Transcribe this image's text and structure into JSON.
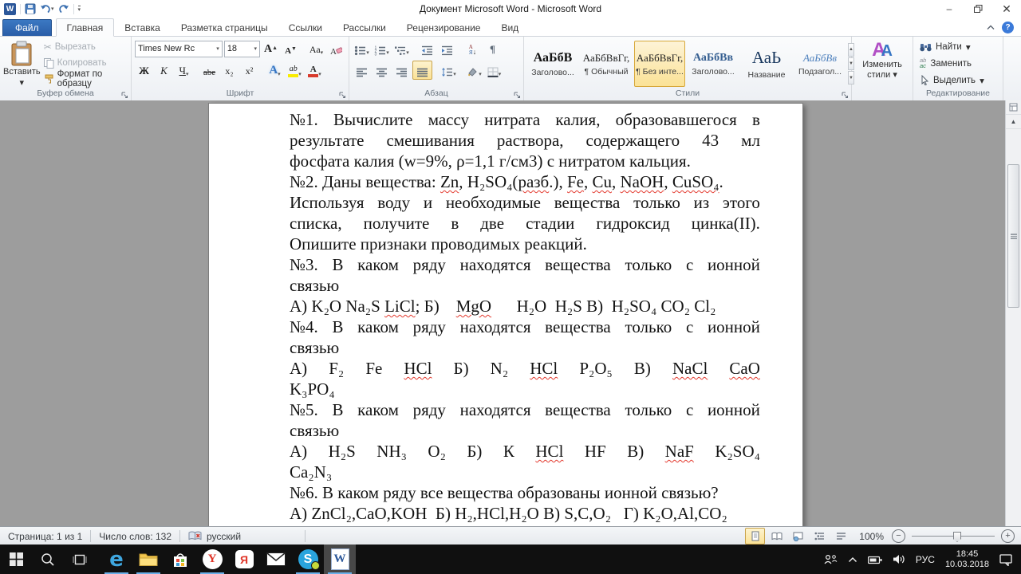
{
  "title_bar": {
    "title": "Документ Microsoft Word  -  Microsoft Word"
  },
  "ribbon": {
    "tabs": [
      {
        "label": "Файл"
      },
      {
        "label": "Главная"
      },
      {
        "label": "Вставка"
      },
      {
        "label": "Разметка страницы"
      },
      {
        "label": "Ссылки"
      },
      {
        "label": "Рассылки"
      },
      {
        "label": "Рецензирование"
      },
      {
        "label": "Вид"
      }
    ],
    "clipboard": {
      "label": "Буфер обмена",
      "paste": "Вставить",
      "cut": "Вырезать",
      "copy": "Копировать",
      "format_painter": "Формат по образцу"
    },
    "font": {
      "label": "Шрифт",
      "name": "Times New Rc",
      "size": "18",
      "bold": "Ж",
      "italic": "К",
      "underline": "Ч",
      "strike": "abe",
      "subscript": "x₂",
      "superscript": "x²",
      "case_btn": "Аа",
      "effects_letter": "А",
      "highlight_letters": "ab",
      "color_letter": "А",
      "highlight_color": "#f9ec00",
      "font_color": "#d83b2d"
    },
    "paragraph": {
      "label": "Абзац",
      "sort_top": "А",
      "sort_bottom": "Я",
      "pilcrow": "¶"
    },
    "styles": {
      "label": "Стили",
      "items": [
        {
          "preview": "АаБбВ",
          "name": "Заголово...",
          "kind": "h1",
          "selected": false
        },
        {
          "preview": "АаБбВвГг,",
          "name": "¶ Обычный",
          "kind": "normal",
          "selected": false
        },
        {
          "preview": "АаБбВвГг,",
          "name": "¶ Без инте...",
          "kind": "normal",
          "selected": true
        },
        {
          "preview": "АаБбВв",
          "name": "Заголово...",
          "kind": "h2",
          "selected": false
        },
        {
          "preview": "АаЬ",
          "name": "Название",
          "kind": "title",
          "selected": false
        },
        {
          "preview": "АаБбВв",
          "name": "Подзагол...",
          "kind": "subtitle",
          "selected": false
        }
      ]
    },
    "change_styles": {
      "line1": "Изменить",
      "line2": "стили"
    },
    "editing": {
      "label": "Редактирование",
      "find": "Найти",
      "replace": "Заменить",
      "select": "Выделить"
    }
  },
  "document": {
    "lines": [
      {
        "j": true,
        "segs": [
          {
            "t": "№1. Вычислите массу нитрата калия, образовавшегося в"
          }
        ]
      },
      {
        "j": true,
        "segs": [
          {
            "t": "результате смешивания раствора, содержащего 43 мл"
          }
        ]
      },
      {
        "j": false,
        "segs": [
          {
            "t": "фосфата калия (w=9%, ρ=1,1 г/см3) с нитратом кальция."
          }
        ]
      },
      {
        "j": false,
        "segs": [
          {
            "t": "№2. Даны вещества: "
          },
          {
            "t": "Zn",
            "e": true
          },
          {
            "t": ", H₂SO₄("
          },
          {
            "t": "разб",
            "e": true
          },
          {
            "t": ".), "
          },
          {
            "t": "Fe",
            "e": true
          },
          {
            "t": ", "
          },
          {
            "t": "Cu",
            "e": true
          },
          {
            "t": ", "
          },
          {
            "t": "NaOH",
            "e": true
          },
          {
            "t": ", "
          },
          {
            "t": "CuSO₄",
            "e": true
          },
          {
            "t": "."
          }
        ]
      },
      {
        "j": true,
        "segs": [
          {
            "t": "Используя воду и необходимые вещества только из этого"
          }
        ]
      },
      {
        "j": true,
        "segs": [
          {
            "t": "списка, получите в две стадии гидроксид цинка(II)."
          }
        ]
      },
      {
        "j": false,
        "segs": [
          {
            "t": "Опишите признаки проводимых реакций."
          }
        ]
      },
      {
        "j": true,
        "segs": [
          {
            "t": "№3. В каком ряду находятся вещества только с ионной"
          }
        ]
      },
      {
        "j": false,
        "segs": [
          {
            "t": "связью"
          }
        ]
      },
      {
        "j": false,
        "segs": [
          {
            "t": "А) K₂O Na₂S "
          },
          {
            "t": "LiCl",
            "e": true
          },
          {
            "t": "; Б)    "
          },
          {
            "t": "MgO",
            "e": true
          },
          {
            "t": "      H₂O  H₂S В)  H₂SO₄ CO₂ Cl₂"
          }
        ]
      },
      {
        "j": true,
        "segs": [
          {
            "t": "№4. В каком ряду находятся вещества только с ионной"
          }
        ]
      },
      {
        "j": false,
        "segs": [
          {
            "t": "связью"
          }
        ]
      },
      {
        "j": true,
        "segs": [
          {
            "t": "А) F₂ Fe "
          },
          {
            "t": "HCl",
            "e": true
          },
          {
            "t": " Б) N₂ "
          },
          {
            "t": "HCl",
            "e": true
          },
          {
            "t": " P₂O₅ В) "
          },
          {
            "t": "NaCl",
            "e": true
          },
          {
            "t": " "
          },
          {
            "t": "CaO",
            "e": true
          }
        ]
      },
      {
        "j": false,
        "segs": [
          {
            "t": "K₃PO₄"
          }
        ]
      },
      {
        "j": true,
        "segs": [
          {
            "t": "№5. В каком ряду находятся вещества только с ионной"
          }
        ]
      },
      {
        "j": false,
        "segs": [
          {
            "t": "связью"
          }
        ]
      },
      {
        "j": true,
        "segs": [
          {
            "t": "А) H₂S NH₃ O₂ Б) К "
          },
          {
            "t": "HCl",
            "e": true
          },
          {
            "t": " HF В) "
          },
          {
            "t": "NaF",
            "e": true
          },
          {
            "t": " K₂SO₄"
          }
        ]
      },
      {
        "j": false,
        "segs": [
          {
            "t": "Ca₂N₃"
          }
        ]
      },
      {
        "j": false,
        "segs": [
          {
            "t": "№6. В каком ряду все вещества образованы ионной связью?"
          }
        ]
      },
      {
        "j": false,
        "segs": [
          {
            "t": "А) ZnCl₂,CaO,KOH  Б) H₂,HCl,H₂O В) S,C,O₂   Г) K₂O,Al,CO₂"
          }
        ]
      }
    ]
  },
  "status_bar": {
    "page": "Страница: 1 из 1",
    "words": "Число слов: 132",
    "language": "русский",
    "zoom": "100%"
  },
  "taskbar": {
    "apps": [
      {
        "icon": "edge-icon",
        "running": true,
        "active": false
      },
      {
        "icon": "explorer-icon",
        "running": true,
        "active": false
      },
      {
        "icon": "store-icon",
        "running": false,
        "active": false
      },
      {
        "icon": "yandex-browser-icon",
        "running": true,
        "active": false
      },
      {
        "icon": "yandex-icon",
        "running": false,
        "active": false
      },
      {
        "icon": "mail-icon",
        "running": false,
        "active": false
      },
      {
        "icon": "skype-icon",
        "running": true,
        "active": false
      },
      {
        "icon": "word-icon",
        "running": true,
        "active": true
      }
    ],
    "tray": {
      "lang": "РУС",
      "time": "18:45",
      "date": "10.03.2018"
    }
  }
}
